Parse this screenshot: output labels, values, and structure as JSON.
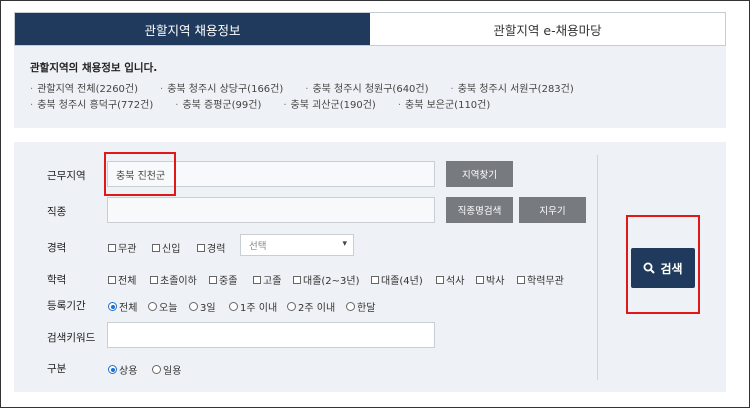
{
  "tabs": [
    {
      "label": "관할지역 채용정보",
      "active": true
    },
    {
      "label": "관할지역 e-채용마당",
      "active": false
    }
  ],
  "info": {
    "title": "관할지역의 채용정보 입니다.",
    "row1": [
      "관할지역 전체(2260건)",
      "충북 청주시 상당구(166건)",
      "충북 청주시 청원구(640건)",
      "충북 청주시 서원구(283건)"
    ],
    "row2": [
      "충북 청주시 흥덕구(772건)",
      "충북 증평군(99건)",
      "충북 괴산군(190건)",
      "충북 보은군(110건)"
    ]
  },
  "form": {
    "workplace_label": "근무지역",
    "workplace_value": "충북 진천군",
    "region_button": "지역찾기",
    "job_label": "직종",
    "job_value": "",
    "job_search_button": "직종명검색",
    "clear_button": "지우기",
    "career_label": "경력",
    "career_options": [
      "무관",
      "신입",
      "경력"
    ],
    "career_select_placeholder": "선택",
    "education_label": "학력",
    "education_options": [
      "전체",
      "초졸이하",
      "중졸",
      "고졸",
      "대졸(2~3년)",
      "대졸(4년)",
      "석사",
      "박사",
      "학력무관"
    ],
    "period_label": "등록기간",
    "period_options": [
      "전체",
      "오늘",
      "3일",
      "1주 이내",
      "2주 이내",
      "한달"
    ],
    "period_selected": "전체",
    "keyword_label": "검색키워드",
    "keyword_value": "",
    "type_label": "구분",
    "type_options": [
      "상용",
      "일용"
    ],
    "type_selected": "상용",
    "search_button": "검색"
  },
  "colors": {
    "accent": "#1f3a5c",
    "highlight": "#e01818",
    "panel_bg": "#eef1f5"
  }
}
